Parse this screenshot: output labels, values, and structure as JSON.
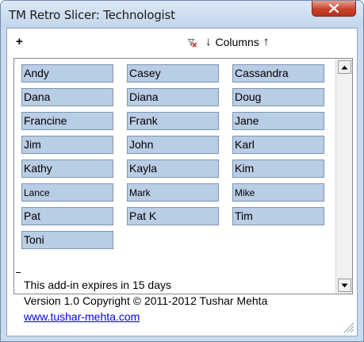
{
  "window": {
    "title": "TM Retro Slicer: Technologist",
    "close_icon": "close-icon"
  },
  "toolbar": {
    "add_label": "+",
    "clear_filter_icon": "clear-filter-icon",
    "decrease_columns_label": "↓",
    "columns_label": "Columns",
    "increase_columns_label": "↑"
  },
  "slicer": {
    "items": [
      {
        "label": "Andy",
        "selected": true
      },
      {
        "label": "Casey",
        "selected": true
      },
      {
        "label": "Cassandra",
        "selected": true
      },
      {
        "label": "Dana",
        "selected": true
      },
      {
        "label": "Diana",
        "selected": true
      },
      {
        "label": "Doug",
        "selected": true
      },
      {
        "label": "Francine",
        "selected": true
      },
      {
        "label": "Frank",
        "selected": true
      },
      {
        "label": "Jane",
        "selected": true
      },
      {
        "label": "Jim",
        "selected": true
      },
      {
        "label": "John",
        "selected": true
      },
      {
        "label": "Karl",
        "selected": true
      },
      {
        "label": "Kathy",
        "selected": true
      },
      {
        "label": "Kayla",
        "selected": true
      },
      {
        "label": "Kim",
        "selected": true
      },
      {
        "label": "Lance",
        "selected": true
      },
      {
        "label": "Mark",
        "selected": true
      },
      {
        "label": "Mike",
        "selected": true
      },
      {
        "label": "Pat",
        "selected": true
      },
      {
        "label": "Pat K",
        "selected": true
      },
      {
        "label": "Tim",
        "selected": true
      },
      {
        "label": "Toni",
        "selected": true
      }
    ],
    "columns": 3,
    "item_color": "#b9cde5",
    "item_border_color": "#7f94b0"
  },
  "footer": {
    "expiry": "This add-in expires in 15 days",
    "copyright": "Version 1.0 Copyright © 2011-2012 Tushar Mehta",
    "link": "www.tushar-mehta.com"
  },
  "colors": {
    "frame": "#c9dbef",
    "close_button": "#c8432c",
    "link": "#0000ee"
  }
}
